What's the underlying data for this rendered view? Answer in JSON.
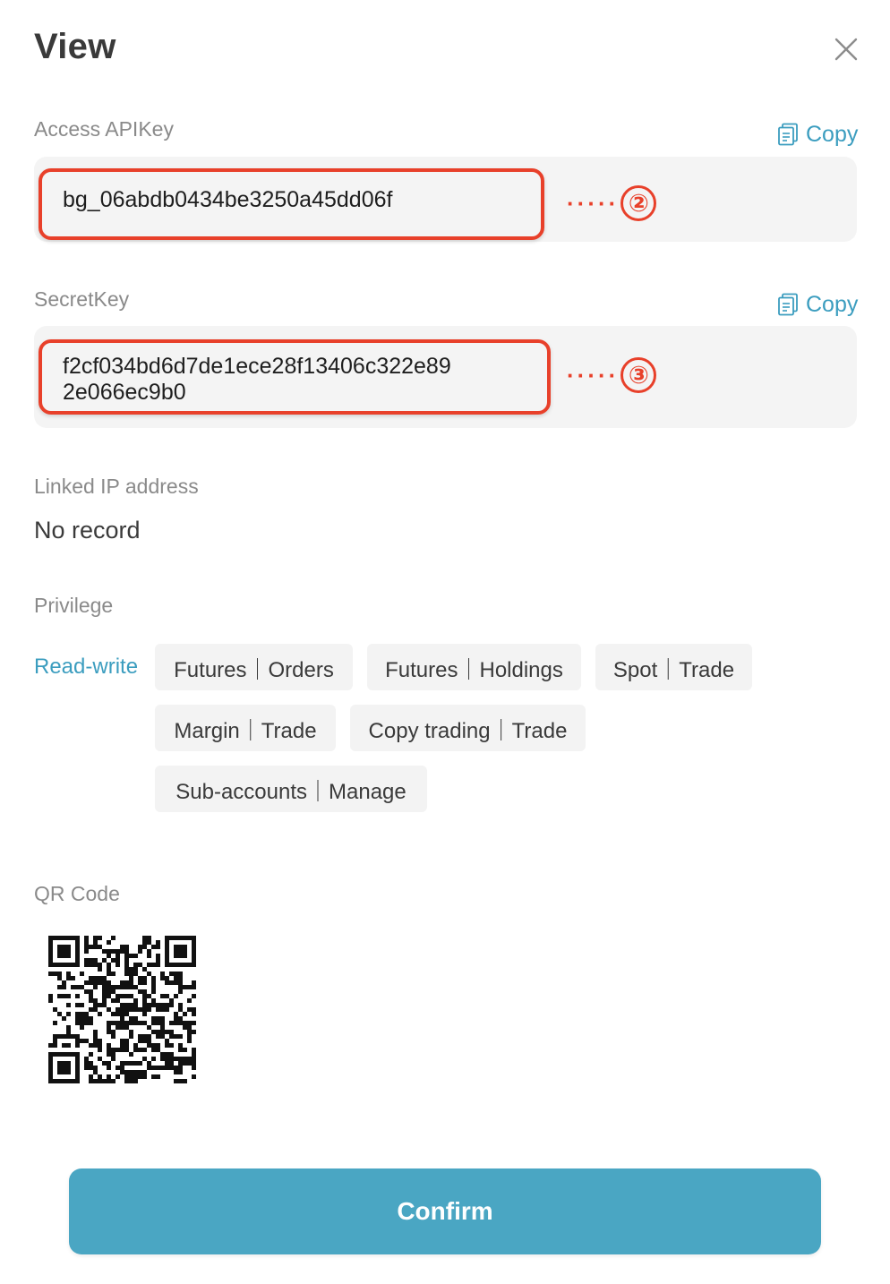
{
  "dialog": {
    "title": "View",
    "close_icon": "close-icon"
  },
  "access_key": {
    "label": "Access APIKey",
    "copy_label": "Copy",
    "value": "bg_06abdb0434be3250a45dd06f",
    "annotation": "②"
  },
  "secret_key": {
    "label": "SecretKey",
    "copy_label": "Copy",
    "line1": "f2cf034bd6d7de1ece28f13406c322e89",
    "line2": "2e066ec9b0",
    "annotation": "③"
  },
  "linked_ip": {
    "label": "Linked IP address",
    "value": "No record"
  },
  "privilege": {
    "label": "Privilege",
    "mode": "Read-write",
    "chips": [
      "Futures｜Orders",
      "Futures｜Holdings",
      "Spot｜Trade",
      "Margin｜Trade",
      "Copy trading｜Trade",
      "Sub-accounts｜Manage"
    ]
  },
  "qr": {
    "label": "QR Code"
  },
  "confirm_label": "Confirm",
  "colors": {
    "accent": "#4aa6c3",
    "link": "#3b9dbf",
    "highlight": "#e8402a"
  }
}
